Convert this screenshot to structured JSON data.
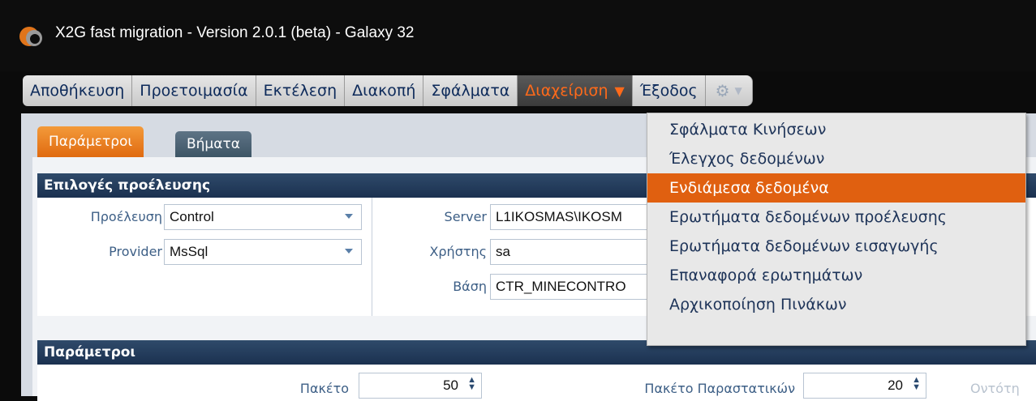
{
  "window": {
    "title": "X2G fast migration - Version 2.0.1 (beta) - Galaxy 32"
  },
  "menu": {
    "items": [
      "Αποθήκευση",
      "Προετοιμασία",
      "Εκτέλεση",
      "Διακοπή",
      "Σφάλματα"
    ],
    "active": "Διαχείριση",
    "exit": "Έξοδος"
  },
  "tabs": {
    "params": "Παράμετροι",
    "steps": "Βήματα"
  },
  "source_section": {
    "title": "Επιλογές προέλευσης",
    "origin_label": "Προέλευση",
    "origin_value": "Control",
    "provider_label": "Provider",
    "provider_value": "MsSql",
    "server_label": "Server",
    "server_value": "L1IKOSMAS\\IKOSM",
    "user_label": "Χρήστης",
    "user_value": "sa",
    "db_label": "Βάση",
    "db_value": "CTR_MINECONTRO"
  },
  "params_section": {
    "title": "Παράμετροι",
    "package_label": "Πακέτο",
    "package_value": "50",
    "doc_package_label": "Πακέτο Παραστατικών",
    "doc_package_value": "20",
    "entity_label": "Οντότη"
  },
  "dropdown": {
    "items": [
      "Σφάλματα Κινήσεων",
      "Έλεγχος δεδομένων",
      "Ενδιάμεσα δεδομένα",
      "Ερωτήματα δεδομένων προέλευσης",
      "Ερωτήματα δεδομένων εισαγωγής",
      "Επαναφορά ερωτημάτων",
      "Αρχικοποίηση Πινάκων"
    ],
    "selected": "Ενδιάμεσα δεδομένα"
  },
  "colors": {
    "accent": "#e06010",
    "menu_active_text": "#ff6a1a",
    "header": "#1b3150"
  }
}
